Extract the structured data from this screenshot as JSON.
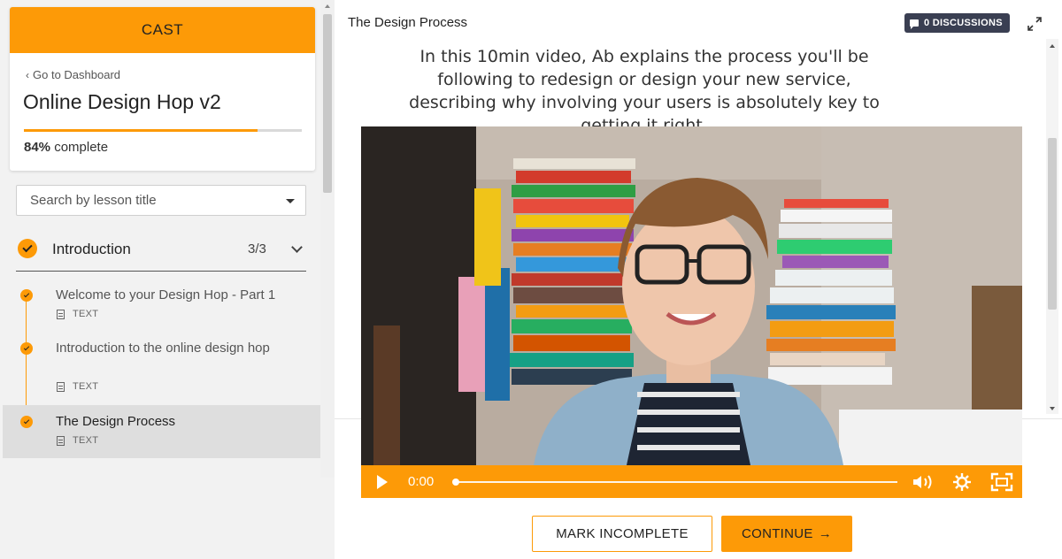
{
  "brand": {
    "name": "CAST",
    "accent_color": "#fd9a07"
  },
  "course": {
    "back_link": "Go to Dashboard",
    "title": "Online Design Hop v2",
    "progress_percent": 84,
    "progress_value": "84%",
    "progress_suffix": "complete"
  },
  "search": {
    "placeholder": "Search by lesson title"
  },
  "section": {
    "title": "Introduction",
    "count": "3/3"
  },
  "lessons": [
    {
      "title": "Welcome to your Design Hop - Part 1",
      "type": "TEXT",
      "completed": true
    },
    {
      "title": "Introduction to the online design hop",
      "type": "TEXT",
      "completed": true
    },
    {
      "title": "The Design Process",
      "type": "TEXT",
      "completed": true,
      "active": true
    }
  ],
  "header": {
    "lesson_title": "The Design Process",
    "discussions_label": "0 DISCUSSIONS"
  },
  "content": {
    "intro_text": "In this 10min video, Ab explains the process you'll be following to redesign or design your new service, describing why involving your users is absolutely key to getting it right."
  },
  "video": {
    "time": "0:00"
  },
  "actions": {
    "mark_incomplete": "MARK INCOMPLETE",
    "continue": "CONTINUE",
    "continue_arrow": "→"
  }
}
